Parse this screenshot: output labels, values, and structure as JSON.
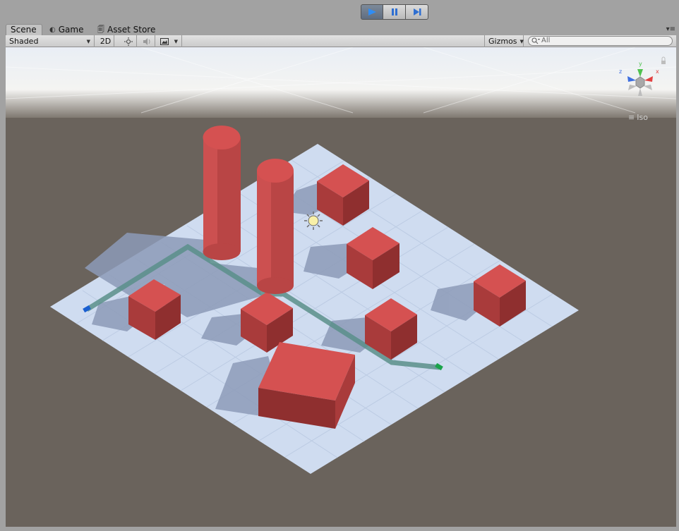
{
  "playbar": {
    "play_icon": "play-icon",
    "pause_icon": "pause-icon",
    "step_icon": "step-icon"
  },
  "tabs": [
    {
      "label": "Scene",
      "icon": "scene-icon",
      "active": true
    },
    {
      "label": "Game",
      "icon": "game-icon",
      "active": false
    },
    {
      "label": "Asset Store",
      "icon": "asset-store-icon",
      "active": false
    }
  ],
  "toolbar": {
    "shading_mode": "Shaded",
    "twod_label": "2D",
    "gizmos_label": "Gizmos",
    "search_placeholder": "All"
  },
  "viewport": {
    "projection_label": "Iso",
    "gizmo_axes": [
      "y",
      "x",
      "z"
    ]
  },
  "colors": {
    "accent_play": "#2f6fd1",
    "ground": "#6a635c",
    "plane": "#cfdcf0",
    "object_red": "#c94545",
    "path": "#5b8f8a"
  }
}
